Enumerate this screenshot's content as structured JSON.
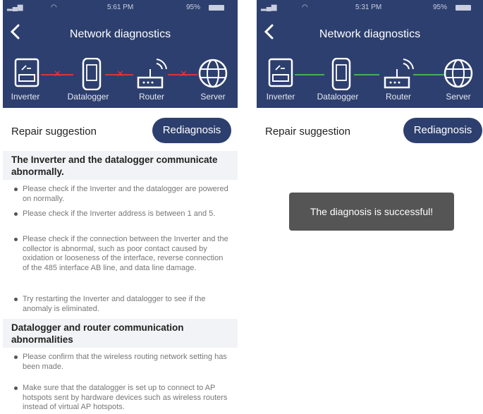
{
  "left": {
    "status": {
      "time": "5:61 PM",
      "battery": "95%"
    },
    "title": "Network diagnostics",
    "devices": [
      "Inverter",
      "Datalogger",
      "Router",
      "Server"
    ],
    "link_status": [
      "failed",
      "failed",
      "failed"
    ],
    "repair_label": "Repair suggestion",
    "rediag_label": "Rediagnosis",
    "sections": [
      {
        "heading": "The Inverter and the datalogger communicate abnormally.",
        "items": [
          "Please check if the Inverter and the datalogger are powered on normally.",
          "Please check if the Inverter address is between 1 and 5.",
          "Please check if the connection between the Inverter and the collector is abnormal, such as poor contact caused by oxidation or looseness of the interface, reverse connection of the 485 interface AB line, and data line damage.",
          "Try restarting the Inverter and datalogger to see if the anomaly is eliminated."
        ]
      },
      {
        "heading": "Datalogger and router communication abnormalities",
        "items": [
          "Please confirm that the wireless routing network setting has been made.",
          "Make sure that the datalogger is set up to connect to AP hotspots sent by hardware devices such as wireless routers instead of virtual AP hotspots."
        ]
      }
    ]
  },
  "right": {
    "status": {
      "time": "5:31 PM",
      "battery": "95%"
    },
    "title": "Network diagnostics",
    "devices": [
      "Inverter",
      "Datalogger",
      "Router",
      "Server"
    ],
    "link_status": [
      "ok",
      "ok",
      "ok"
    ],
    "repair_label": "Repair suggestion",
    "rediag_label": "Rediagnosis",
    "toast": "The diagnosis is successful!"
  },
  "colors": {
    "header": "#2d3f6e",
    "link_failed": "#d93636",
    "link_ok": "#45b25a",
    "toast_bg": "#555555"
  }
}
